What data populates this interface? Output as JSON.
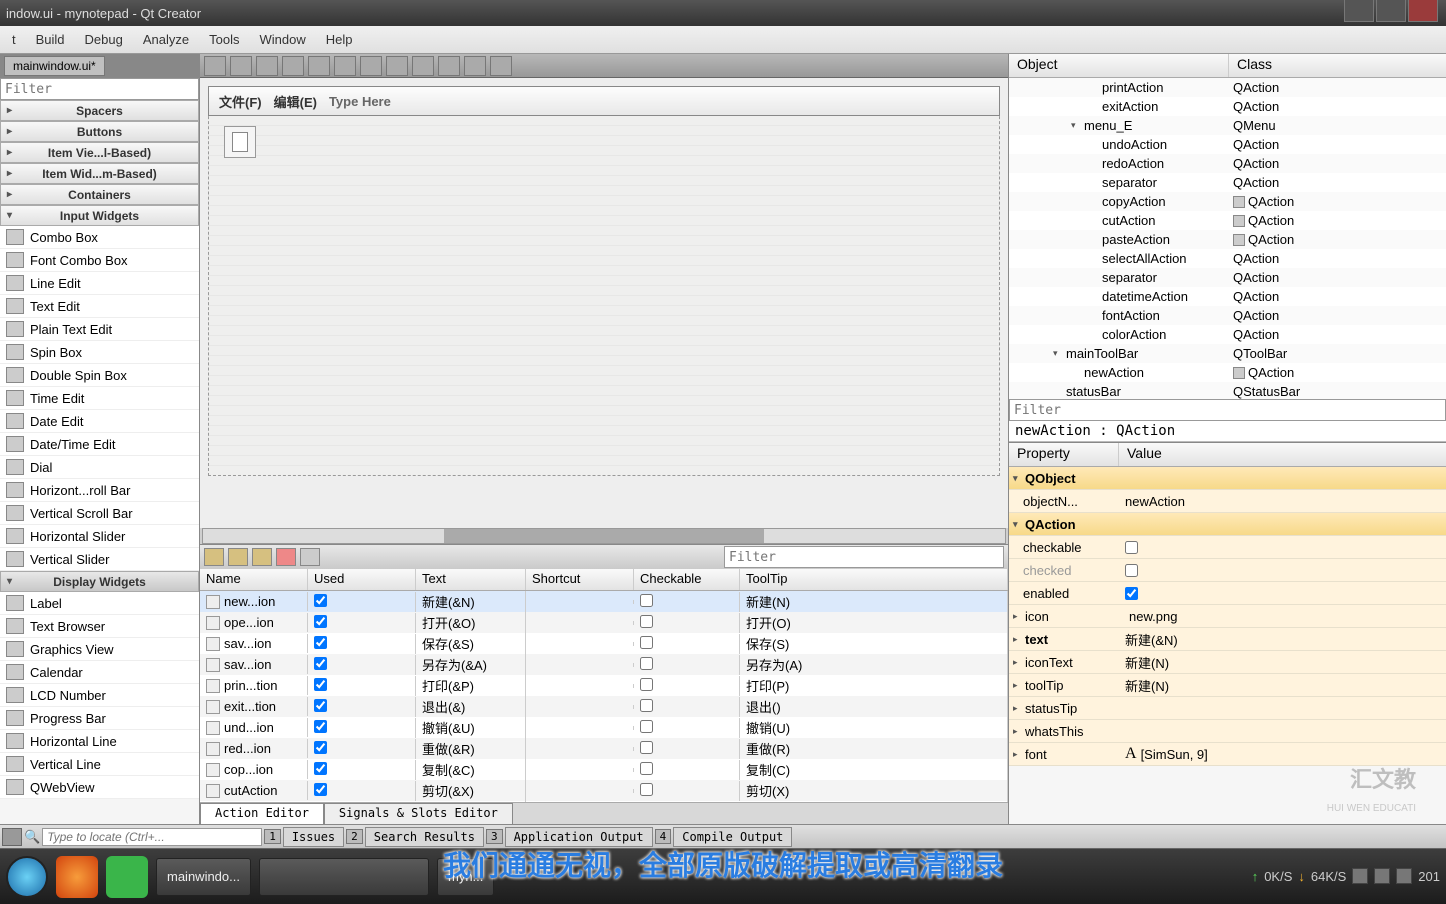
{
  "window": {
    "title": "indow.ui - mynotepad - Qt Creator"
  },
  "menu": {
    "items": [
      "t",
      "Build",
      "Debug",
      "Analyze",
      "Tools",
      "Window",
      "Help"
    ]
  },
  "docTab": "mainwindow.ui*",
  "filterPlaceholder": "Filter",
  "widgetCats": {
    "spacers": "Spacers",
    "buttons": "Buttons",
    "itemViews": "Item Vie...l-Based)",
    "itemWidgets": "Item Wid...m-Based)",
    "containers": "Containers",
    "input": "Input Widgets",
    "display": "Display Widgets"
  },
  "inputWidgets": [
    "Combo Box",
    "Font Combo Box",
    "Line Edit",
    "Text Edit",
    "Plain Text Edit",
    "Spin Box",
    "Double Spin Box",
    "Time Edit",
    "Date Edit",
    "Date/Time Edit",
    "Dial",
    "Horizont...roll Bar",
    "Vertical Scroll Bar",
    "Horizontal Slider",
    "Vertical Slider"
  ],
  "displayWidgets": [
    "Label",
    "Text Browser",
    "Graphics View",
    "Calendar",
    "LCD Number",
    "Progress Bar",
    "Horizontal Line",
    "Vertical Line",
    "QWebView"
  ],
  "formMenu": {
    "file": "文件(F)",
    "edit": "编辑(E)",
    "typeHere": "Type Here"
  },
  "actionEditor": {
    "filterPlaceholder": "Filter",
    "headers": {
      "name": "Name",
      "used": "Used",
      "text": "Text",
      "shortcut": "Shortcut",
      "checkable": "Checkable",
      "tooltip": "ToolTip"
    },
    "rows": [
      {
        "name": "new...ion",
        "used": true,
        "text": "新建(&N)",
        "checkable": false,
        "tip": "新建(N)",
        "sel": true
      },
      {
        "name": "ope...ion",
        "used": true,
        "text": "打开(&O)",
        "checkable": false,
        "tip": "打开(O)"
      },
      {
        "name": "sav...ion",
        "used": true,
        "text": "保存(&S)",
        "checkable": false,
        "tip": "保存(S)"
      },
      {
        "name": "sav...ion",
        "used": true,
        "text": "另存为(&A)",
        "checkable": false,
        "tip": "另存为(A)"
      },
      {
        "name": "prin...tion",
        "used": true,
        "text": "打印(&P)",
        "checkable": false,
        "tip": "打印(P)"
      },
      {
        "name": "exit...tion",
        "used": true,
        "text": "退出(&)",
        "checkable": false,
        "tip": "退出()"
      },
      {
        "name": "und...ion",
        "used": true,
        "text": "撤销(&U)",
        "checkable": false,
        "tip": "撤销(U)"
      },
      {
        "name": "red...ion",
        "used": true,
        "text": "重做(&R)",
        "checkable": false,
        "tip": "重做(R)"
      },
      {
        "name": "cop...ion",
        "used": true,
        "text": "复制(&C)",
        "checkable": false,
        "tip": "复制(C)"
      },
      {
        "name": "cutAction",
        "used": true,
        "text": "剪切(&X)",
        "checkable": false,
        "tip": "剪切(X)"
      }
    ],
    "tabs": {
      "actionEditor": "Action Editor",
      "signals": "Signals & Slots Editor"
    }
  },
  "objectTree": {
    "headers": {
      "object": "Object",
      "class": "Class"
    },
    "rows": [
      {
        "name": "printAction",
        "class": "QAction",
        "ind": 80
      },
      {
        "name": "exitAction",
        "class": "QAction",
        "ind": 80
      },
      {
        "name": "menu_E",
        "class": "QMenu",
        "ind": 62,
        "exp": true
      },
      {
        "name": "undoAction",
        "class": "QAction",
        "ind": 80
      },
      {
        "name": "redoAction",
        "class": "QAction",
        "ind": 80
      },
      {
        "name": "separator",
        "class": "QAction",
        "ind": 80
      },
      {
        "name": "copyAction",
        "class": "QAction",
        "ind": 80,
        "hasIcon": true
      },
      {
        "name": "cutAction",
        "class": "QAction",
        "ind": 80,
        "hasIcon": true
      },
      {
        "name": "pasteAction",
        "class": "QAction",
        "ind": 80,
        "hasIcon": true
      },
      {
        "name": "selectAllAction",
        "class": "QAction",
        "ind": 80
      },
      {
        "name": "separator",
        "class": "QAction",
        "ind": 80
      },
      {
        "name": "datetimeAction",
        "class": "QAction",
        "ind": 80
      },
      {
        "name": "fontAction",
        "class": "QAction",
        "ind": 80
      },
      {
        "name": "colorAction",
        "class": "QAction",
        "ind": 80
      },
      {
        "name": "mainToolBar",
        "class": "QToolBar",
        "ind": 44,
        "exp": true
      },
      {
        "name": "newAction",
        "class": "QAction",
        "ind": 62,
        "hasIcon": true
      },
      {
        "name": "statusBar",
        "class": "QStatusBar",
        "ind": 44
      }
    ]
  },
  "propPanel": {
    "filterPlaceholder": "Filter",
    "title": "newAction : QAction",
    "headers": {
      "property": "Property",
      "value": "Value"
    },
    "groups": {
      "qobject": "QObject",
      "qaction": "QAction"
    },
    "rows": [
      {
        "k": "objectN...",
        "v": "newAction"
      },
      {
        "k": "checkable",
        "v": "",
        "chk": false
      },
      {
        "k": "checked",
        "v": "",
        "chk": false,
        "dim": true
      },
      {
        "k": "enabled",
        "v": "",
        "chk": true
      },
      {
        "k": "icon",
        "v": "new.png",
        "exp": true,
        "hasIcon": true
      },
      {
        "k": "text",
        "v": "新建(&N)",
        "exp": true,
        "bold": true
      },
      {
        "k": "iconText",
        "v": "新建(N)",
        "exp": true
      },
      {
        "k": "toolTip",
        "v": "新建(N)",
        "exp": true
      },
      {
        "k": "statusTip",
        "v": "",
        "exp": true
      },
      {
        "k": "whatsThis",
        "v": "",
        "exp": true
      },
      {
        "k": "font",
        "v": "[SimSun, 9]",
        "exp": true,
        "fontA": true
      }
    ]
  },
  "locator": {
    "placeholder": "Type to locate (Ctrl+...",
    "tabs": [
      {
        "n": "1",
        "l": "Issues"
      },
      {
        "n": "2",
        "l": "Search Results"
      },
      {
        "n": "3",
        "l": "Application Output"
      },
      {
        "n": "4",
        "l": "Compile Output"
      }
    ]
  },
  "taskbar": {
    "app1": "mainwindo...",
    "app2": "myn..."
  },
  "netspeed": {
    "up": "0K/S",
    "down": "64K/S"
  },
  "subtitle": "我们通通无视，全部原版破解提取或高清翻录",
  "watermark": "汇文教",
  "watermarkSub": "HUI WEN EDUCATI"
}
